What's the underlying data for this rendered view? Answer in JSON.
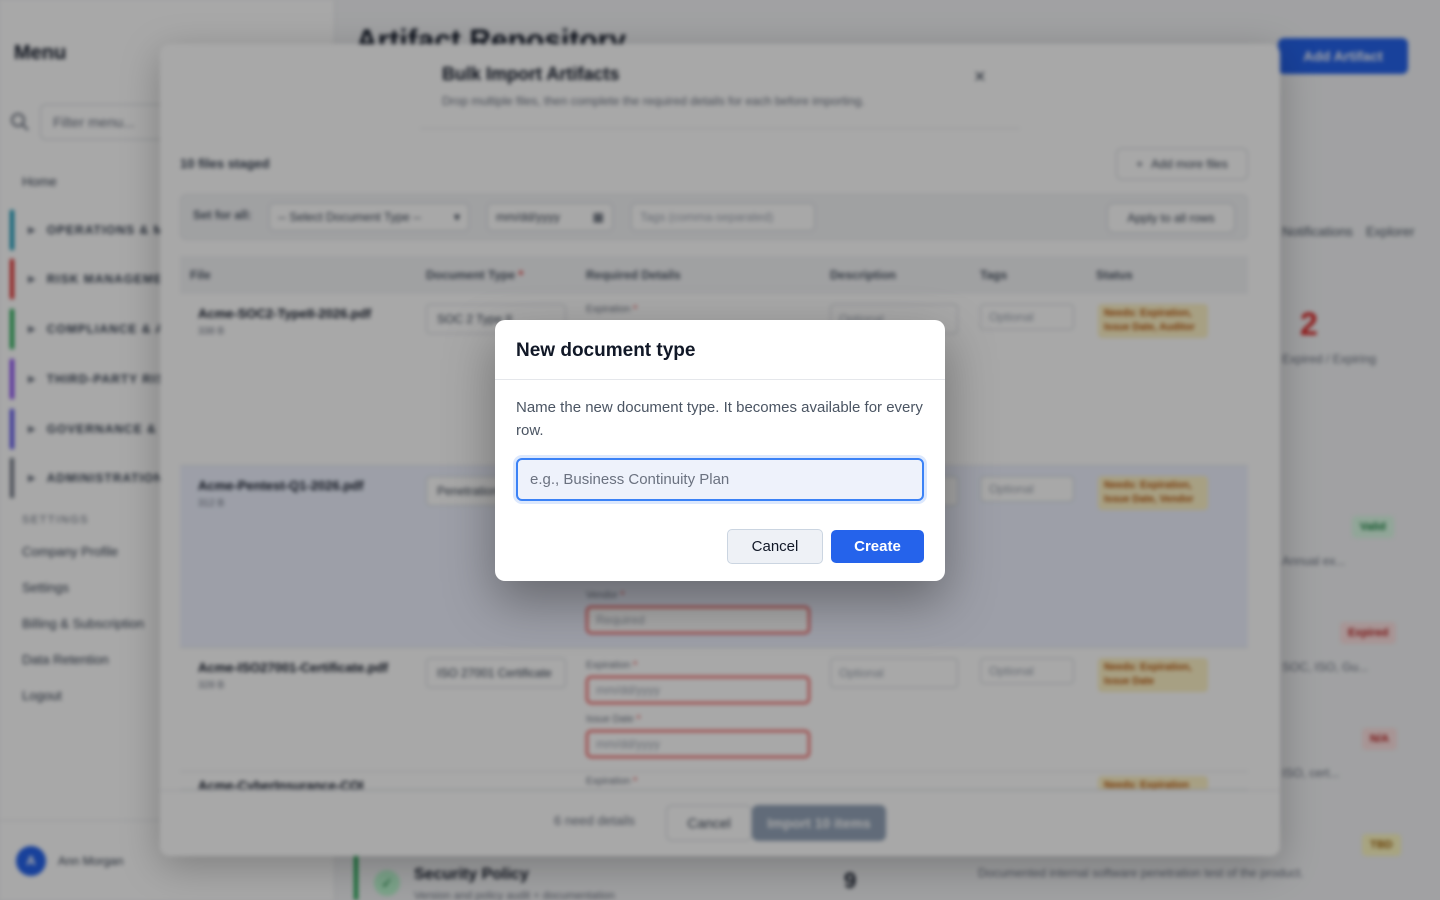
{
  "sidebar": {
    "title": "Menu",
    "search_placeholder": "Filter menu...",
    "home": "Home",
    "groups": [
      {
        "label": "OPERATIONS & MONITORING",
        "color": "#0891b2"
      },
      {
        "label": "RISK MANAGEMENT",
        "color": "#dc2626"
      },
      {
        "label": "COMPLIANCE & AUDIT",
        "color": "#16a34a"
      },
      {
        "label": "THIRD-PARTY RISK",
        "color": "#7c3aed"
      },
      {
        "label": "GOVERNANCE & POLICY",
        "color": "#4f46e5"
      },
      {
        "label": "ADMINISTRATION",
        "color": "#6b7280"
      }
    ],
    "settings_heading": "SETTINGS",
    "settings_links": [
      "Company Profile",
      "Settings",
      "Billing & Subscription",
      "Data Retention",
      "Logout"
    ],
    "user": {
      "initial": "A",
      "name": "Ann Morgan"
    }
  },
  "main": {
    "title": "Artifact Repository",
    "add_button": "Add Artifact",
    "tabs": [
      "Notifications",
      "Explorer"
    ],
    "stat": {
      "value": "2",
      "label": "Expired / Expiring"
    },
    "badges": [
      {
        "text": "Valid",
        "bg": "#dcfce7",
        "fg": "#15803d"
      },
      {
        "text": "Expired",
        "bg": "#fee2e2",
        "fg": "#b91c1c"
      },
      {
        "text": "N/A",
        "bg": "#fee2e2",
        "fg": "#b91c1c"
      },
      {
        "text": "TBD",
        "bg": "#fef9c3",
        "fg": "#a16207"
      }
    ],
    "snippets": [
      "Annual ex...",
      "SOC, ISO, Gu...",
      "ISO, cert..."
    ],
    "security_policy": {
      "title": "Security Policy",
      "subtitle": "Version and policy audit + documentation",
      "count": "9",
      "description": "Documented internal software penetration test of the product."
    }
  },
  "bulk": {
    "title": "Bulk Import Artifacts",
    "subtitle": "Drop multiple files, then complete the required details for each before importing.",
    "close": "×",
    "staged_count": "10 files staged",
    "add_more": "Add more files",
    "set_all_label": "Set for all:",
    "set_all_type": "-- Select Document Type --",
    "set_all_date": "mm/dd/yyyy",
    "set_all_tags": "Tags (comma-separated)",
    "apply_all": "Apply to all rows",
    "columns": {
      "file": "File",
      "type": "Document Type",
      "required": "Required Details",
      "description": "Description",
      "tags": "Tags",
      "status": "Status"
    },
    "rows": [
      {
        "name": "Acme-SOC2-TypeII-2026.pdf",
        "size": "338 B",
        "type": "SOC 2 Type II",
        "fields": [
          "Expiration"
        ],
        "status": "Needs: Expiration, Issue Date, Auditor"
      },
      {
        "name": "Acme-Pentest-Q1-2026.pdf",
        "size": "312 B",
        "type": "Penetration Test",
        "fields": [
          "Vendor"
        ],
        "status": "Needs: Expiration, Issue Date, Vendor"
      },
      {
        "name": "Acme-ISO27001-Certificate.pdf",
        "size": "328 B",
        "type": "ISO 27001 Certificate",
        "fields": [
          "Expiration",
          "Issue Date"
        ],
        "status": "Needs: Expiration, Issue Date"
      },
      {
        "name": "Acme-CyberInsurance-COI",
        "size": "",
        "type": "",
        "fields": [
          "Expiration"
        ],
        "status": "Needs: Expiration"
      }
    ],
    "placeholders": {
      "date": "mm/dd/yyyy",
      "required": "Required",
      "optional": "Optional"
    },
    "footer": {
      "need_details": "6 need details",
      "cancel": "Cancel",
      "import": "Import 10 items"
    }
  },
  "dialog": {
    "title": "New document type",
    "body": "Name the new document type. It becomes available for every row.",
    "input_placeholder": "e.g., Business Continuity Plan",
    "input_value": "",
    "cancel": "Cancel",
    "create": "Create",
    "accent": "#2563eb"
  }
}
